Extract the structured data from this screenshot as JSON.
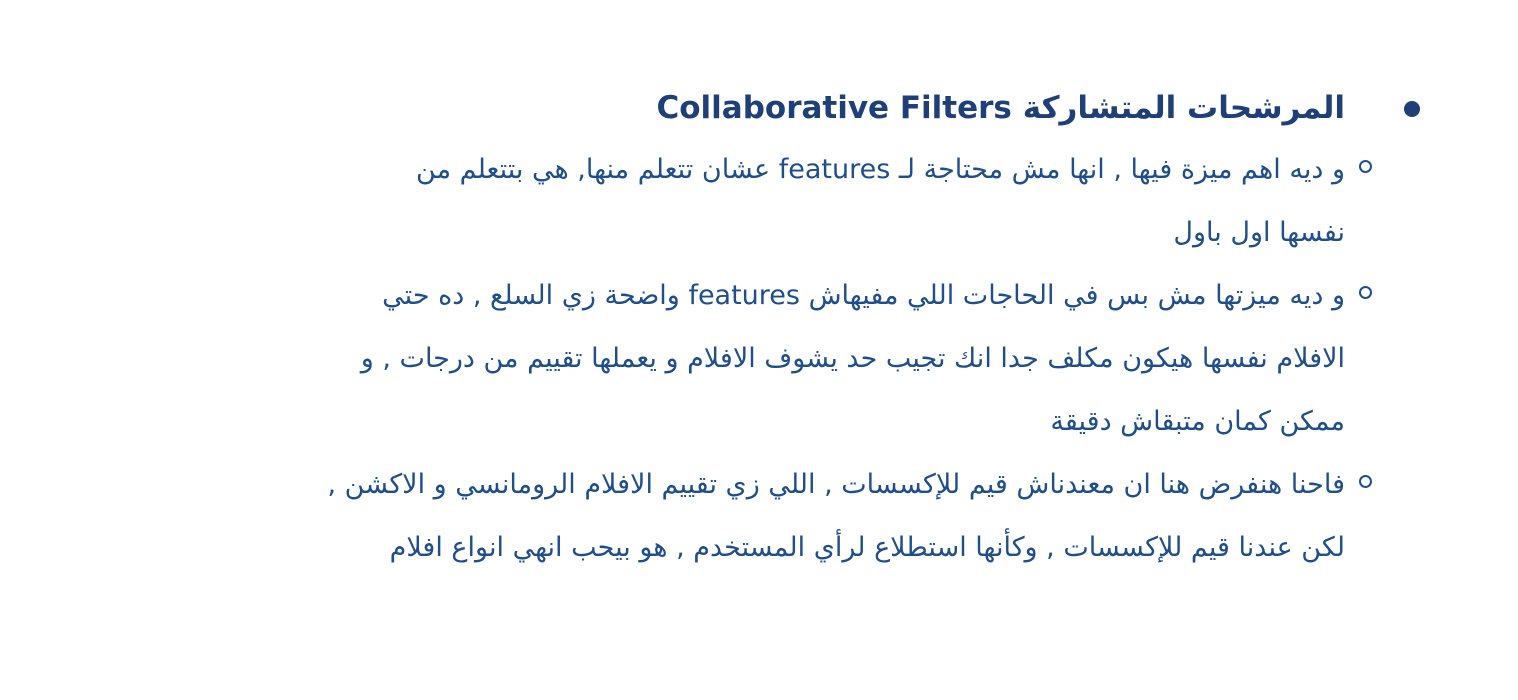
{
  "heading": {
    "ar": "المرشحات المتشاركة",
    "en": "Collaborative Filters"
  },
  "items": [
    {
      "lines": [
        "و ديه اهم ميزة فيها , انها مش محتاجة لـ features عشان تتعلم منها, هي بتتعلم من",
        "نفسها اول باول"
      ]
    },
    {
      "lines": [
        "و ديه ميزتها مش بس في الحاجات اللي مفيهاش features واضحة زي السلع , ده حتي",
        "الافلام نفسها هيكون مكلف جدا انك تجيب حد يشوف الافلام و يعملها تقييم من درجات , و",
        "ممكن كمان متبقاش دقيقة"
      ]
    },
    {
      "lines": [
        "فاحنا هنفرض هنا ان معندناش قيم للإكسسات , اللي زي تقييم الافلام الرومانسي و الاكشن ,",
        "لكن عندنا قيم للإكسسات , وكأنها استطلاع لرأي المستخدم , هو بيحب انهي انواع افلام"
      ]
    }
  ]
}
